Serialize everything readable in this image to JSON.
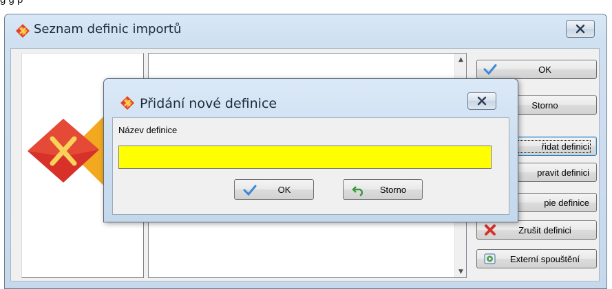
{
  "top_fragment": "g  g p",
  "main_window": {
    "title": "Seznam definic importů",
    "buttons": [
      {
        "label": "OK",
        "icon": "check-icon"
      },
      {
        "label": "Storno",
        "icon": "undo-icon"
      },
      {
        "label": "Přidat definici",
        "visible": "řidat definici",
        "icon": "add-icon"
      },
      {
        "label": "Opravit definici",
        "visible": "pravit definici",
        "icon": "edit-icon"
      },
      {
        "label": "Kopie definice",
        "visible": "pie definice",
        "icon": "copy-icon"
      },
      {
        "label": "Zrušit definici",
        "icon": "delete-icon"
      },
      {
        "label": "Externí spouštění",
        "icon": "external-run-icon"
      }
    ]
  },
  "dialog": {
    "title": "Přidání nové definice",
    "field_label": "Název definice",
    "field_value": "",
    "ok_label": "OK",
    "cancel_label": "Storno"
  },
  "colors": {
    "input_highlight": "#ffff00",
    "logo_red": "#d8312a",
    "logo_orange": "#f2a81f"
  }
}
